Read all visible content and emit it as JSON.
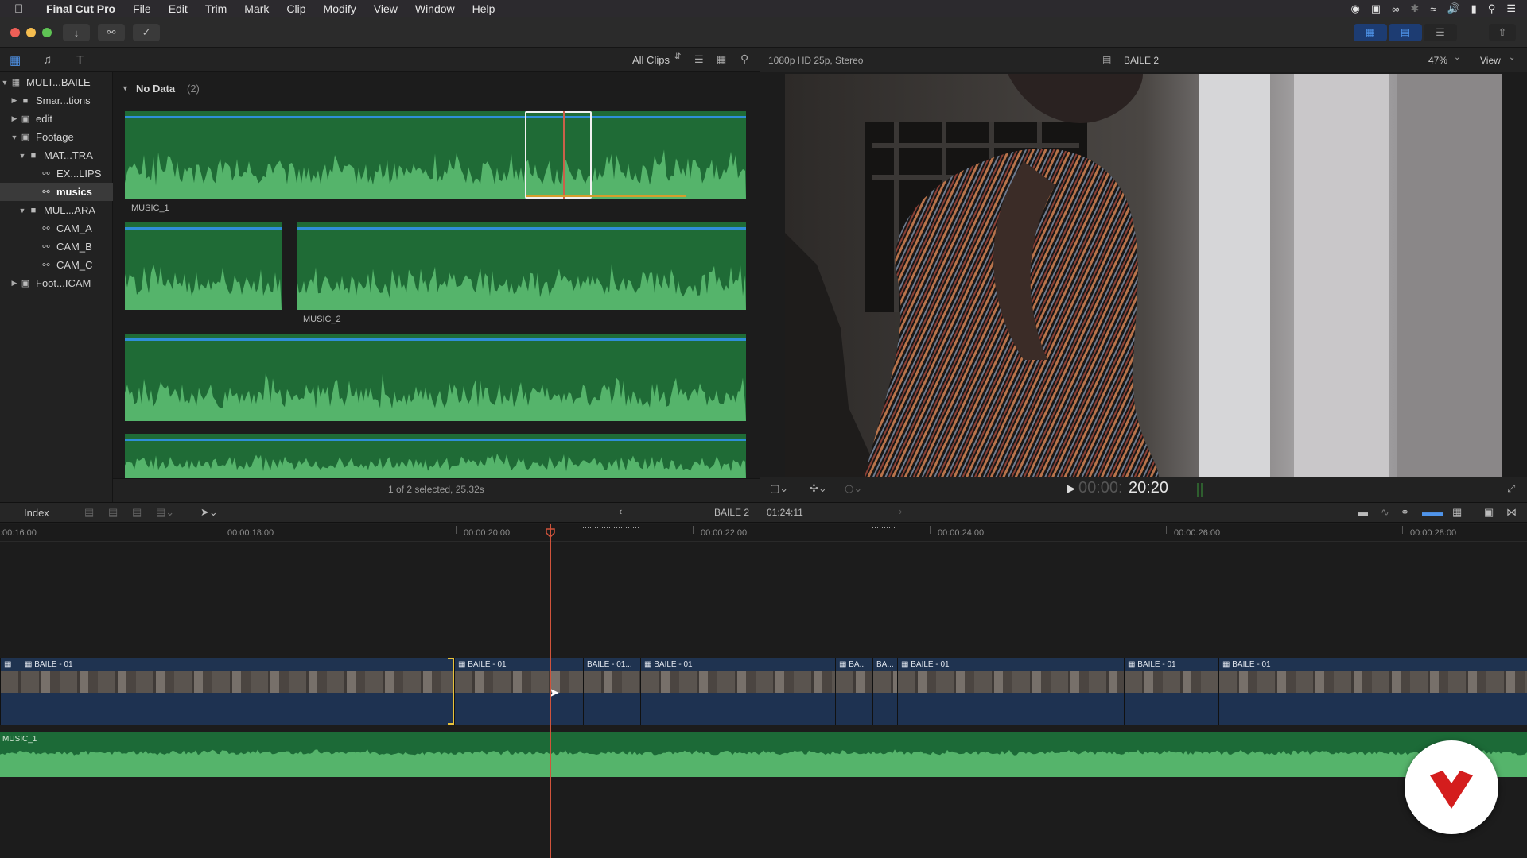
{
  "menubar": {
    "app_name": "Final Cut Pro",
    "items": [
      "File",
      "Edit",
      "Trim",
      "Mark",
      "Clip",
      "Modify",
      "View",
      "Window",
      "Help"
    ]
  },
  "browser": {
    "filter_label": "All Clips",
    "group_title": "No Data",
    "group_count": "(2)",
    "status": "1 of 2 selected, 25.32s",
    "clips": [
      {
        "label": "MUSIC_1"
      },
      {
        "label": "MUSIC_2"
      }
    ]
  },
  "libraries": {
    "items": [
      {
        "label": "MULT...BAILE",
        "icon": "library-icon"
      },
      {
        "label": "Smar...tions",
        "icon": "folder-icon"
      },
      {
        "label": "edit",
        "icon": "event-icon"
      },
      {
        "label": "Footage",
        "icon": "event-icon"
      },
      {
        "label": "MAT...TRA",
        "icon": "folder-icon"
      },
      {
        "label": "EX...LIPS",
        "icon": "keyword-icon"
      },
      {
        "label": "musics",
        "icon": "keyword-icon"
      },
      {
        "label": "MUL...ARA",
        "icon": "folder-icon"
      },
      {
        "label": "CAM_A",
        "icon": "keyword-icon"
      },
      {
        "label": "CAM_B",
        "icon": "keyword-icon"
      },
      {
        "label": "CAM_C",
        "icon": "keyword-icon"
      },
      {
        "label": "Foot...ICAM",
        "icon": "event-icon"
      }
    ]
  },
  "viewer": {
    "format": "1080p HD 25p, Stereo",
    "clip_name": "BAILE 2",
    "zoom": "47%",
    "view_label": "View",
    "timecode_dim": "00:00:",
    "timecode": "20:20"
  },
  "timeline": {
    "index_label": "Index",
    "project_name": "BAILE 2",
    "duration": "01:24:11",
    "ruler": [
      ":00:16:00",
      "00:00:18:00",
      "00:00:20:00",
      "00:00:22:00",
      "00:00:24:00",
      "00:00:26:00",
      "00:00:28:00"
    ],
    "clips": [
      "BAILE - 01",
      "BAILE - 01",
      "BAILE - 01...",
      "BAILE - 01",
      "BA...",
      "BA...",
      "BAILE - 01",
      "BAILE - 01",
      "BAILE - 01"
    ],
    "audio_label": "MUSIC_1"
  },
  "colors": {
    "accent": "#2f8ed8",
    "audio_green": "#1f6b36",
    "playhead": "#d0533b",
    "video_clip": "#1f3350"
  }
}
